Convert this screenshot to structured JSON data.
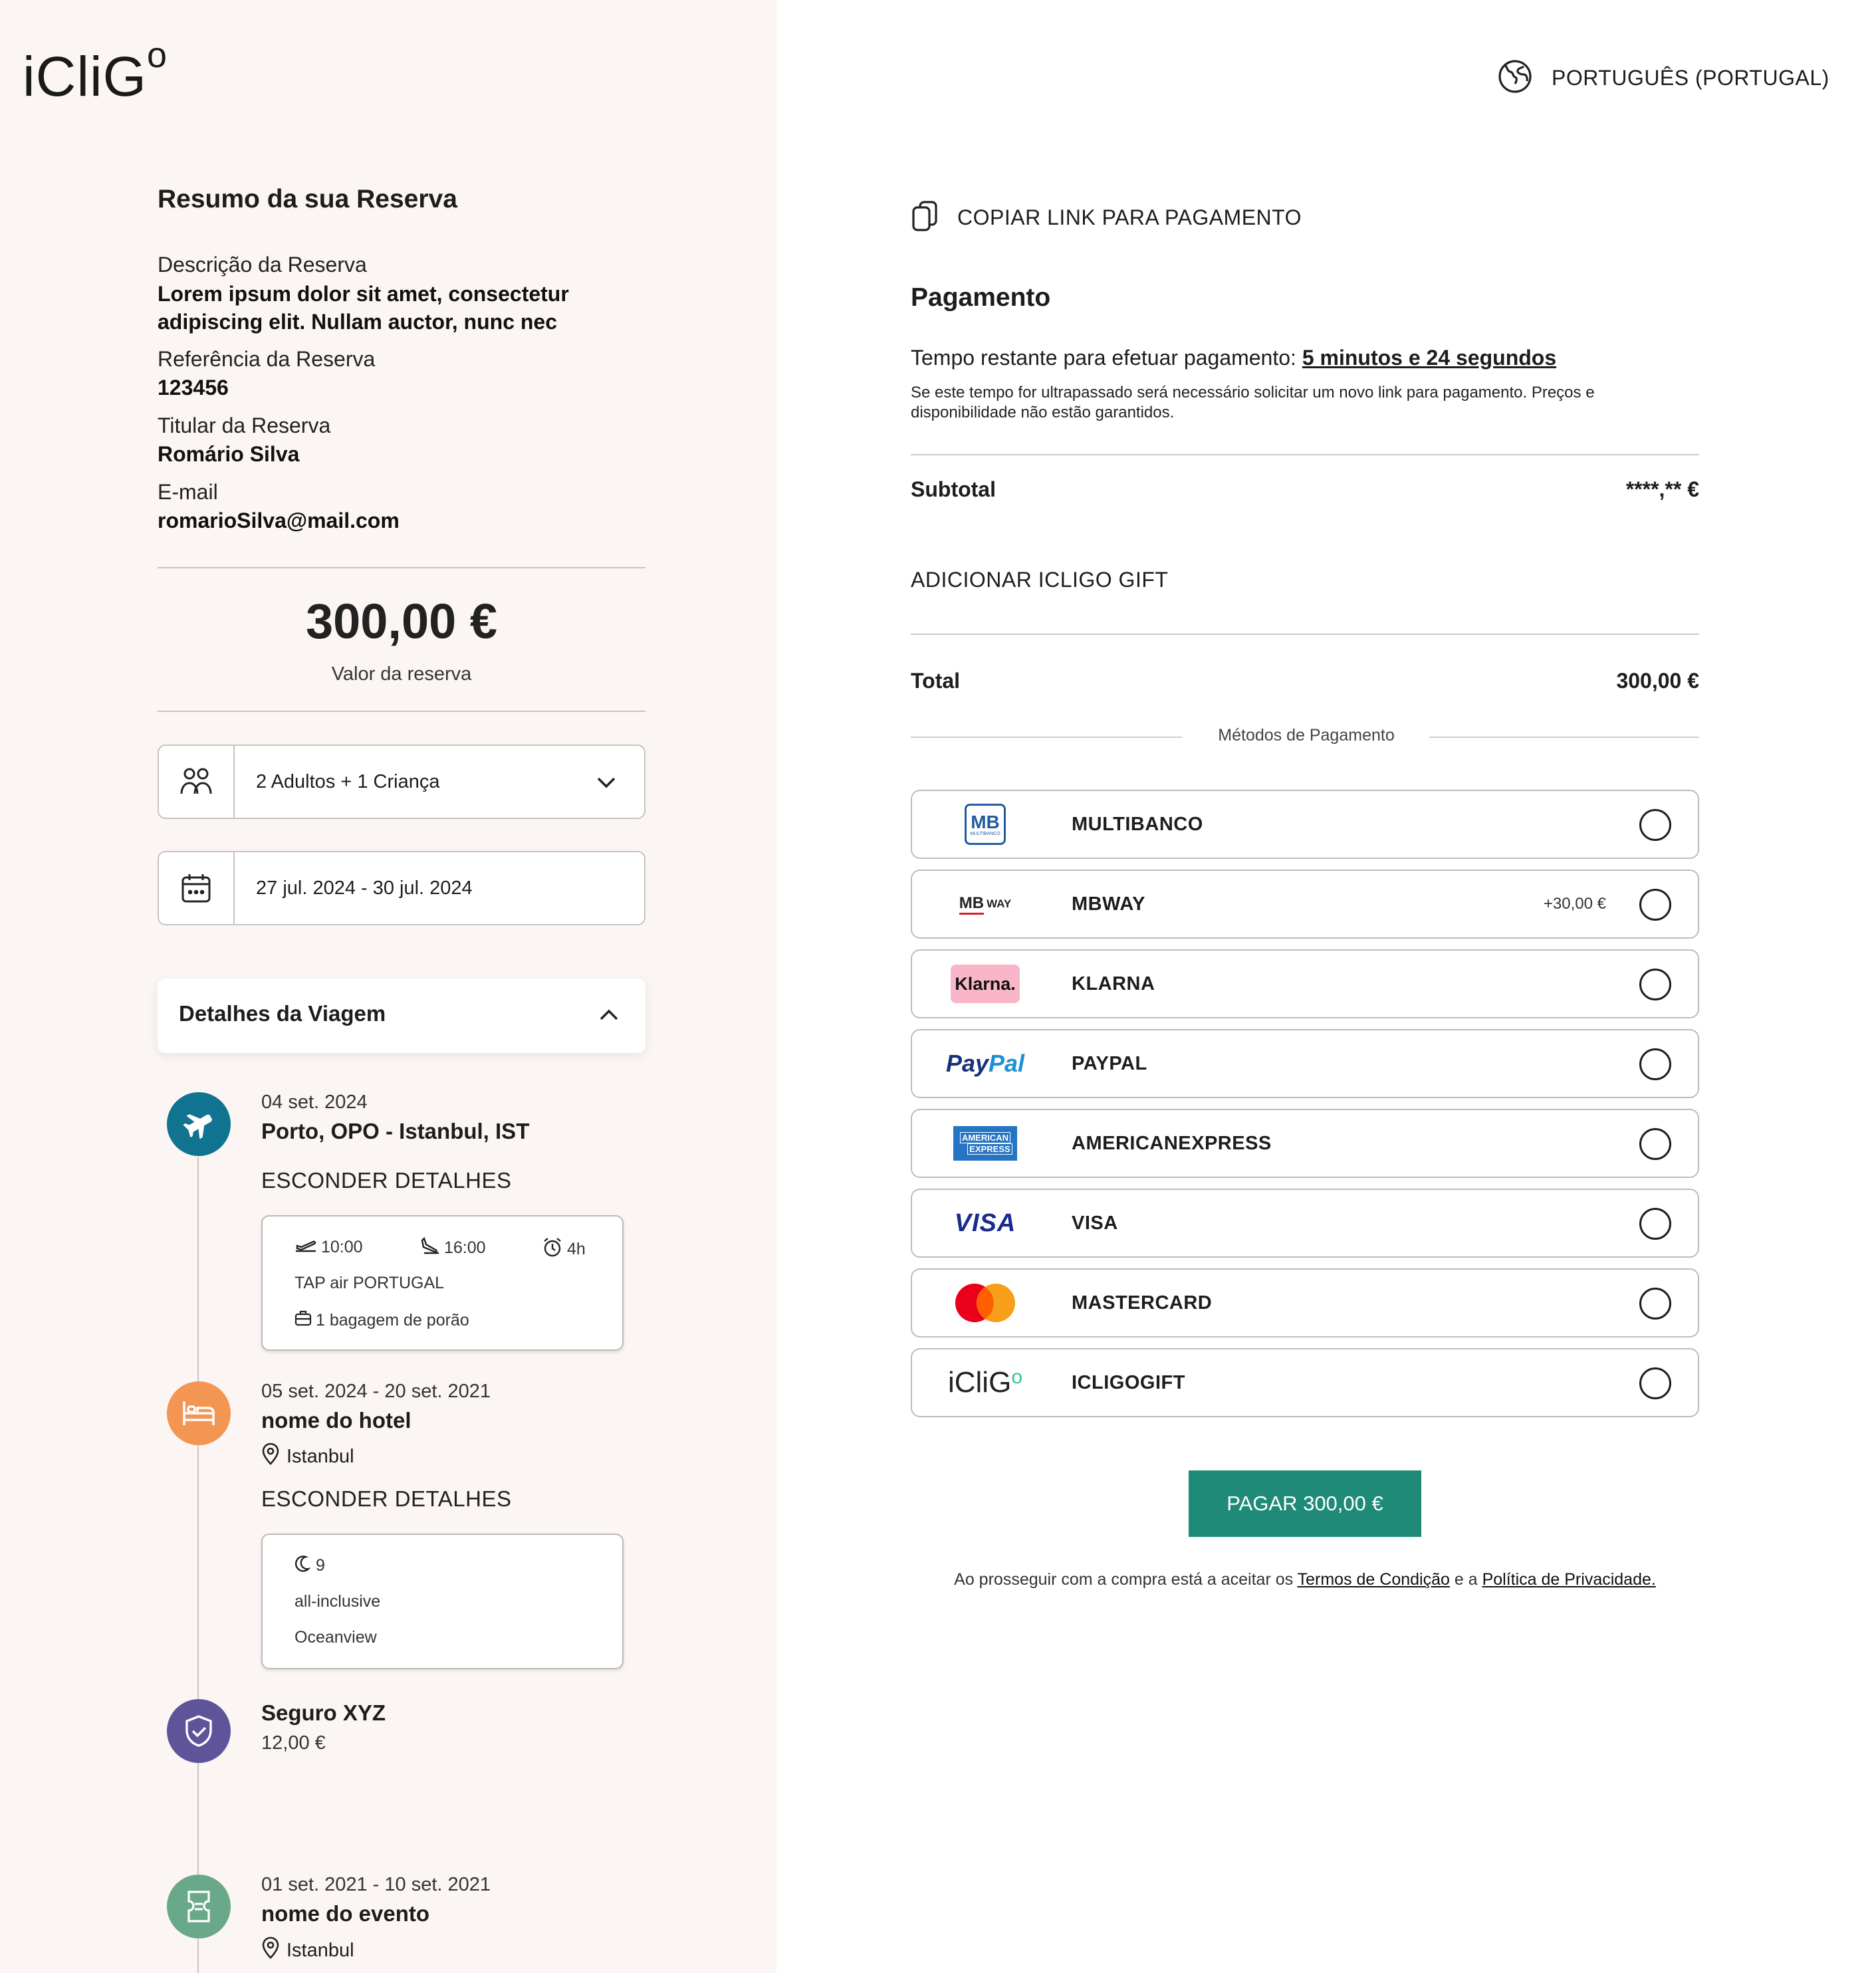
{
  "brand": {
    "logo_main": "iCliG",
    "logo_sup": "o"
  },
  "language": {
    "label": "PORTUGUÊS (PORTUGAL)",
    "icon": "globe-icon"
  },
  "summary": {
    "title": "Resumo da sua Reserva",
    "description_label": "Descrição da Reserva",
    "description_value": "Lorem ipsum dolor sit amet, consectetur adipiscing elit. Nullam auctor, nunc nec",
    "reference_label": "Referência da Reserva",
    "reference_value": "123456",
    "holder_label": "Titular da Reserva",
    "holder_value": "Romário Silva",
    "email_label": "E-mail",
    "email_value": "romarioSilva@mail.com",
    "amount": "300,00 €",
    "amount_label": "Valor da reserva"
  },
  "travelers": {
    "value": "2 Adultos + 1 Criança",
    "icon": "people-icon"
  },
  "dates": {
    "value": "27 jul. 2024 - 30 jul. 2024",
    "icon": "calendar-icon"
  },
  "trip_details": {
    "title": "Detalhes da Viagem",
    "items": [
      {
        "date": "04 set. 2024",
        "title": "Porto, OPO - Istanbul, IST",
        "toggle": "ESCONDER DETALHES",
        "depart": "10:00",
        "arrive": "16:00",
        "duration": "4h",
        "airline": "TAP air PORTUGAL",
        "baggage": "1 bagagem de porão",
        "color": "#10738f"
      },
      {
        "date": "05 set. 2024 - 20 set. 2021",
        "title": "nome do hotel",
        "location": "Istanbul",
        "toggle": "ESCONDER DETALHES",
        "nights": "9",
        "board": "all-inclusive",
        "room": "Oceanview",
        "color": "#f39553"
      },
      {
        "title": "Seguro XYZ",
        "price": "12,00 €",
        "color": "#5e5499"
      },
      {
        "date": "01 set. 2021 - 10 set. 2021",
        "title": "nome do evento",
        "location": "Istanbul",
        "color": "#6aa88a"
      }
    ]
  },
  "payment": {
    "copy_link": "COPIAR LINK PARA PAGAMENTO",
    "title": "Pagamento",
    "time_label": "Tempo restante para efetuar pagamento: ",
    "time_value": "5 minutos e 24 segundos",
    "warning": "Se este tempo for ultrapassado será necessário solicitar um novo link para pagamento. Preços e disponibilidade não estão garantidos.",
    "subtotal_label": "Subtotal",
    "subtotal_value": "****,** €",
    "gift_label": "ADICIONAR ICLIGO GIFT",
    "total_label": "Total",
    "total_value": "300,00 €",
    "methods_label": "Métodos de Pagamento",
    "methods": [
      {
        "name": "MULTIBANCO",
        "logo": "MB",
        "logo_sub": "MULTIBANCO"
      },
      {
        "name": "MBWAY",
        "logo": "MB",
        "logo_sub": "WAY",
        "extra": "+30,00 €"
      },
      {
        "name": "KLARNA",
        "logo": "Klarna."
      },
      {
        "name": "PAYPAL",
        "logo_a": "Pay",
        "logo_b": "Pal"
      },
      {
        "name": "AMERICANEXPRESS",
        "logo": "AMERICAN",
        "logo_sub": "EXPRESS"
      },
      {
        "name": "VISA",
        "logo": "VISA"
      },
      {
        "name": "MASTERCARD",
        "logo": "mastercard-icon"
      },
      {
        "name": "ICLIGOGIFT",
        "logo": "iCliG",
        "logo_sup": "o"
      }
    ],
    "pay_button": "PAGAR 300,00 €",
    "terms_prefix": "Ao prosseguir com a compra está a aceitar os ",
    "terms_link": "Termos de Condição",
    "terms_mid": " e a ",
    "privacy_link": "Política de Privacidade.",
    "colors": {
      "pay_button": "#1f8a78",
      "gift_accent": "#2ec4a0"
    }
  }
}
